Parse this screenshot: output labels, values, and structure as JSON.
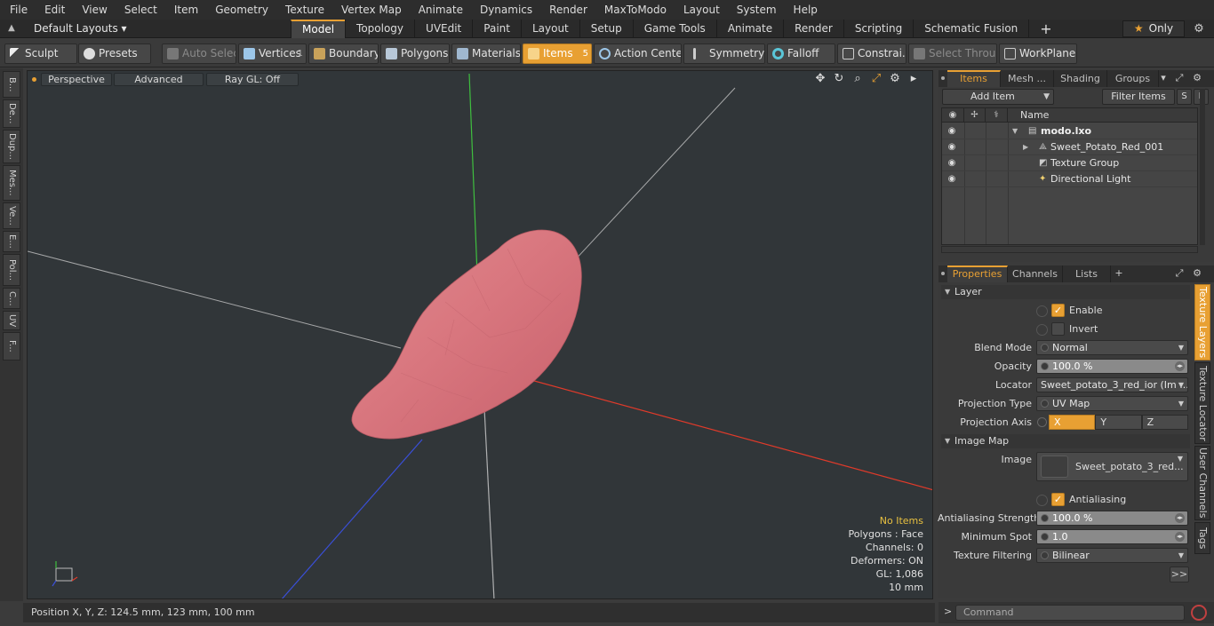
{
  "menu": [
    "File",
    "Edit",
    "View",
    "Select",
    "Item",
    "Geometry",
    "Texture",
    "Vertex Map",
    "Animate",
    "Dynamics",
    "Render",
    "MaxToModo",
    "Layout",
    "System",
    "Help"
  ],
  "layout": {
    "selector": "Default Layouts ▾"
  },
  "tabs": [
    "Model",
    "Topology",
    "UVEdit",
    "Paint",
    "Layout",
    "Setup",
    "Game Tools",
    "Animate",
    "Render",
    "Scripting",
    "Schematic Fusion"
  ],
  "tabs_active": "Model",
  "tab_add": "+",
  "only_label": "Only",
  "toolbar": {
    "sculpt": "Sculpt",
    "presets": "Presets",
    "auto_select": "Auto Select",
    "vertices": "Vertices",
    "vertices_count": "1",
    "boundary": "Boundary",
    "polygons": "Polygons",
    "materials": "Materials",
    "items": "Items",
    "items_count": "5",
    "action_center": "Action Center",
    "symmetry": "Symmetry",
    "falloff": "Falloff",
    "constraints": "Constrai...",
    "select_through": "Select Through",
    "workplane": "WorkPlane"
  },
  "left_tabs": [
    "B...",
    "De...",
    "Dup...",
    "Mes...",
    "Ve...",
    "E...",
    "Pol...",
    "C...",
    "UV",
    "F..."
  ],
  "viewport": {
    "perspective": "Perspective",
    "advanced": "Advanced",
    "raygl": "Ray GL: Off",
    "info": {
      "no_items": "No Items",
      "polygons": "Polygons : Face",
      "channels": "Channels: 0",
      "deformers": "Deformers: ON",
      "gl": "GL: 1,086",
      "scale": "10 mm"
    },
    "colors": {
      "background": "#313639",
      "mesh": "#d9777f",
      "x_axis": "#e03a2a",
      "y_axis": "#3fbf3f",
      "z_axis": "#3a4fd8"
    }
  },
  "status": {
    "position": "Position X, Y, Z:   124.5 mm, 123 mm, 100 mm"
  },
  "items_panel": {
    "tabs": [
      "Items",
      "Mesh ...",
      "Shading",
      "Groups"
    ],
    "add_item": "Add Item",
    "filter_items": "Filter Items",
    "s_btn": "S",
    "f_btn": "F",
    "name_col": "Name",
    "tree": [
      {
        "label": "modo.lxo",
        "level": 0
      },
      {
        "label": "Sweet_Potato_Red_001",
        "level": 1
      },
      {
        "label": "Texture Group",
        "level": 1
      },
      {
        "label": "Directional Light",
        "level": 1
      }
    ]
  },
  "props_panel": {
    "tabs": [
      "Properties",
      "Channels",
      "Lists"
    ],
    "tab_add": "+",
    "layer_section": "Layer",
    "enable": "Enable",
    "invert": "Invert",
    "blend_mode_label": "Blend Mode",
    "blend_mode": "Normal",
    "opacity_label": "Opacity",
    "opacity": "100.0 %",
    "locator_label": "Locator",
    "locator": "Sweet_potato_3_red_ior (Im ...",
    "projection_type_label": "Projection Type",
    "projection_type": "UV Map",
    "projection_axis_label": "Projection Axis",
    "axes": [
      "X",
      "Y",
      "Z"
    ],
    "axis_active": "X",
    "image_map_section": "Image Map",
    "image_label": "Image",
    "image": "Sweet_potato_3_red...",
    "antialiasing": "Antialiasing",
    "aa_strength_label": "Antialiasing Strength",
    "aa_strength": "100.0 %",
    "min_spot_label": "Minimum Spot",
    "min_spot": "1.0",
    "tex_filter_label": "Texture Filtering",
    "tex_filter": "Bilinear",
    "more": ">>",
    "side_tabs": [
      "Texture Layers",
      "Texture Locator",
      "User Channels",
      "Tags"
    ]
  },
  "command": {
    "prompt": ">",
    "placeholder": "Command"
  },
  "accent": "#e8a033"
}
